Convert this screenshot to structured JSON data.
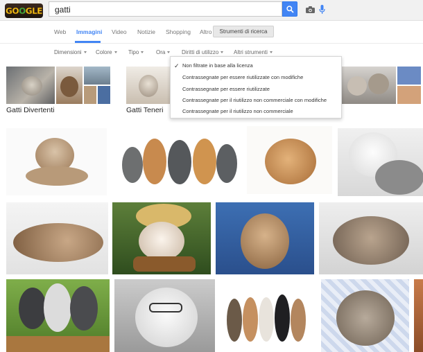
{
  "header": {
    "logo_text": "GOOGLE",
    "query": "gatti",
    "icons": [
      "camera-icon",
      "microphone-icon",
      "search-icon"
    ]
  },
  "tabs": [
    {
      "label": "Web",
      "active": false
    },
    {
      "label": "Immagini",
      "active": true
    },
    {
      "label": "Video",
      "active": false
    },
    {
      "label": "Notizie",
      "active": false
    },
    {
      "label": "Shopping",
      "active": false
    },
    {
      "label": "Altro",
      "active": false
    }
  ],
  "search_tools_label": "Strumenti di ricerca",
  "filters": [
    "Dimensioni",
    "Colore",
    "Tipo",
    "Ora",
    "Diritti di utilizzo",
    "Altri strumenti"
  ],
  "related": [
    {
      "label": "Gatti Divertenti"
    },
    {
      "label": "Gatti Teneri"
    }
  ],
  "usage_rights_menu": {
    "selected": "Non filtrate in base alla licenza",
    "options": [
      "Non filtrate in base alla licenza",
      "Contrassegnate per essere riutilizzate con modifiche",
      "Contrassegnate per essere riutilizzate",
      "Contrassegnate per il riutilizzo non commerciale con modifiche",
      "Contrassegnate per il riutilizzo non commerciale"
    ]
  },
  "colors": {
    "accent": "#4285f4",
    "tab_inactive": "#777777",
    "topbar_bg": "#f1f1f1"
  }
}
